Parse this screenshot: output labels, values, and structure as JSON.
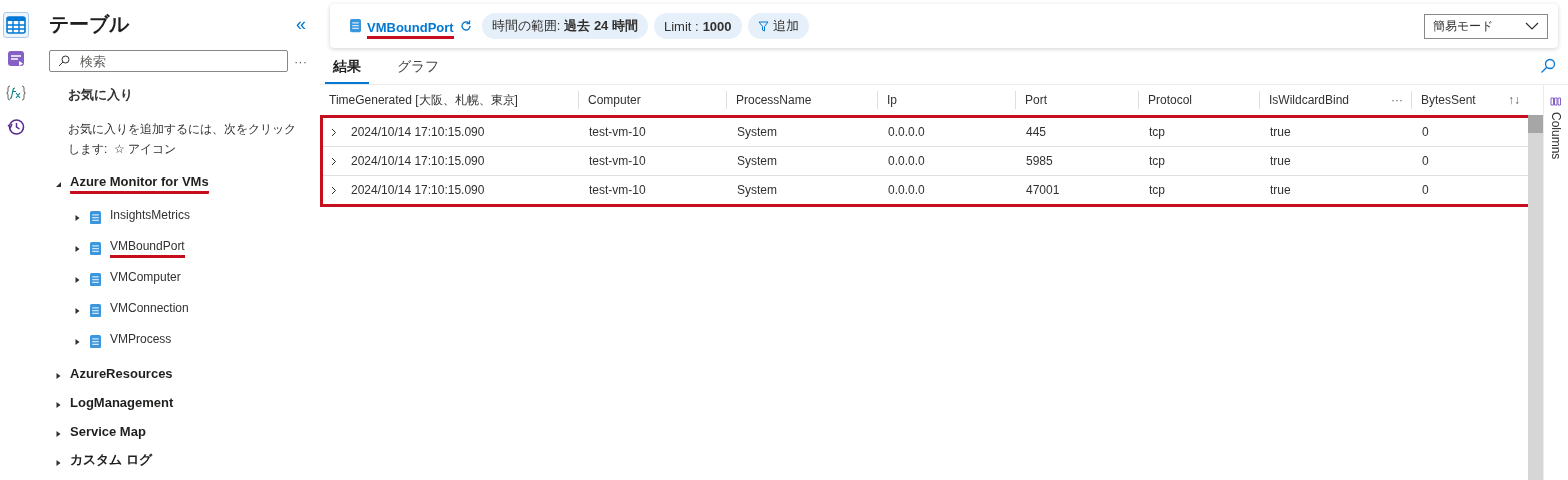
{
  "rail": [
    {
      "kind": "tables",
      "selected": true
    },
    {
      "kind": "queries",
      "selected": false
    },
    {
      "kind": "functions",
      "selected": false
    },
    {
      "kind": "history",
      "selected": false
    }
  ],
  "sidebar": {
    "title": "テーブル",
    "collapse": "«",
    "search": {
      "placeholder": "検索"
    },
    "more": "···",
    "favorites": {
      "title": "お気に入り",
      "hint": "お気に入りを追加するには、次をクリックします:  ☆ アイコン"
    },
    "tree": [
      {
        "label": "Azure Monitor for VMs",
        "expanded": true,
        "underlined": true,
        "children": [
          {
            "label": "InsightsMetrics",
            "underlined": false
          },
          {
            "label": "VMBoundPort",
            "underlined": true
          },
          {
            "label": "VMComputer",
            "underlined": false
          },
          {
            "label": "VMConnection",
            "underlined": false
          },
          {
            "label": "VMProcess",
            "underlined": false
          }
        ]
      },
      {
        "label": "AzureResources",
        "expanded": false,
        "underlined": false
      },
      {
        "label": "LogManagement",
        "expanded": false,
        "underlined": false
      },
      {
        "label": "Service Map",
        "expanded": false,
        "underlined": false
      },
      {
        "label": "カスタム ログ",
        "expanded": false,
        "underlined": false
      }
    ]
  },
  "toolbar": {
    "table": "VMBoundPort",
    "table_underlined": true,
    "pills": [
      {
        "kind": "range",
        "label": "時間の範囲: ",
        "value": "過去 24 時間"
      },
      {
        "kind": "limit",
        "label": "Limit : ",
        "value": "1000"
      },
      {
        "kind": "filter",
        "label": "追加"
      }
    ],
    "mode": "簡易モード"
  },
  "tabs": [
    {
      "label": "結果",
      "selected": true
    },
    {
      "label": "グラフ",
      "selected": false
    }
  ],
  "table": {
    "columns": [
      "TimeGenerated [大阪、札幌、東京]",
      "Computer",
      "ProcessName",
      "Ip",
      "Port",
      "Protocol",
      "IsWildcardBind",
      "BytesSent"
    ],
    "column_menu": "···",
    "sort": "↑↓",
    "rows_outlined": true,
    "rows": [
      [
        "2024/10/14 17:10:15.090",
        "test-vm-10",
        "System",
        "0.0.0.0",
        "445",
        "tcp",
        "true",
        "0"
      ],
      [
        "2024/10/14 17:10:15.090",
        "test-vm-10",
        "System",
        "0.0.0.0",
        "5985",
        "tcp",
        "true",
        "0"
      ],
      [
        "2024/10/14 17:10:15.090",
        "test-vm-10",
        "System",
        "0.0.0.0",
        "47001",
        "tcp",
        "true",
        "0"
      ]
    ]
  },
  "columns_panel": "Columns"
}
